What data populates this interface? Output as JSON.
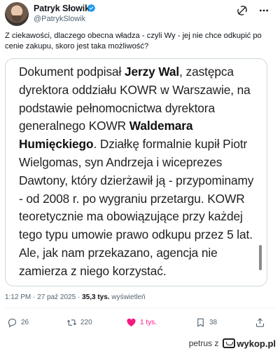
{
  "author": {
    "name": "Patryk Słowik",
    "handle": "@PatrykSlowik"
  },
  "tweet": {
    "text": "Z ciekawości, dlaczego obecna władza - czyli Wy - jej nie chce odkupić po cenie zakupu, skoro jest taka możliwość?"
  },
  "card": {
    "segments": [
      {
        "text": "Dokument podpisał ",
        "bold": false
      },
      {
        "text": "Jerzy Wal",
        "bold": true
      },
      {
        "text": ", zastępca dyrektora oddziału KOWR w Warszawie, na podstawie pełnomocnictwa dyrektora generalnego KOWR ",
        "bold": false
      },
      {
        "text": "Waldemara Humięckiego",
        "bold": true
      },
      {
        "text": ". Działkę formalnie kupił Piotr Wielgomas, syn Andrzeja i wiceprezes Dawtony, który dzierżawił ją - przypominamy - od 2008 r. po wygraniu przetargu. KOWR teoretycznie ma obowiązujące przy każdej tego typu umowie prawo odkupu przez 5 lat. Ale, jak nam przekazano, agencja nie zamierza z niego korzystać.",
        "bold": false
      }
    ]
  },
  "meta": {
    "time": "1:12 PM · 27 paź 2025 ·",
    "views": "35,3 tys.",
    "views_label": "wyświetleń"
  },
  "actions": {
    "replies": "26",
    "reposts": "220",
    "likes": "1 tys.",
    "bookmarks": "38"
  },
  "colors": {
    "verified": "#1d9bf0",
    "like": "#f91880",
    "muted": "#536471"
  },
  "watermark": {
    "source": "petrus z",
    "logo": "wykop.pl"
  }
}
